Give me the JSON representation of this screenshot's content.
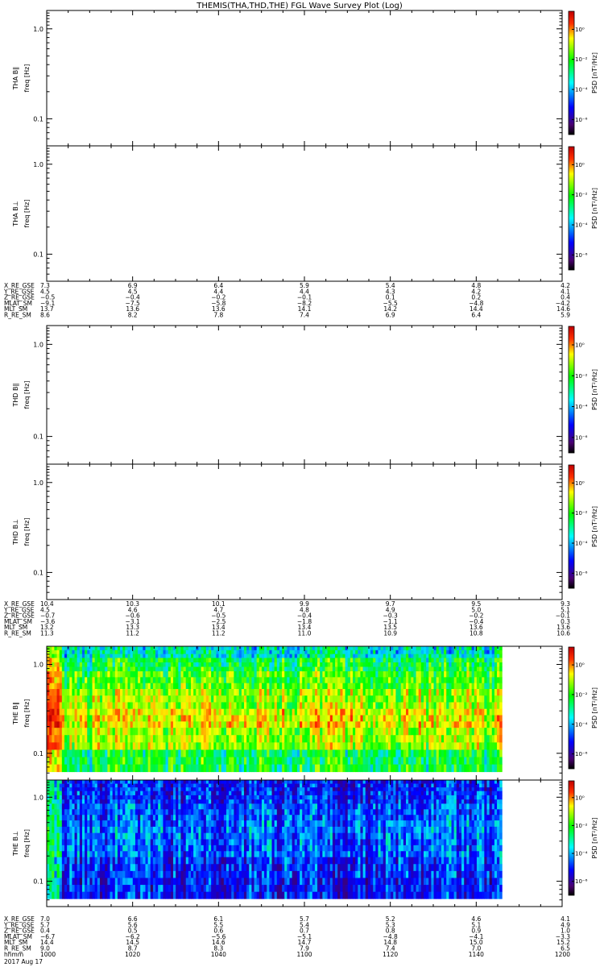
{
  "title": "THEMIS(THA,THD,THE) FGL Wave Survey Plot (Log)",
  "chart_data": {
    "type": "heatmap",
    "yscale": "log",
    "ylim_hz": [
      0.05,
      1.6
    ],
    "yticks": [
      "1.0",
      "0.1"
    ],
    "colorbar": {
      "label": "PSD [nT²/Hz]",
      "ticks": [
        "10⁰",
        "10⁻²",
        "10⁻⁴",
        "10⁻⁶"
      ],
      "colors": [
        "#ffffff",
        "#e00000",
        "#ffff00",
        "#00ff00",
        "#00ffff",
        "#0000ff",
        "#000000"
      ]
    },
    "panels": [
      {
        "probe": "THA",
        "component": "B∥",
        "label": "THA B∥",
        "sublabel": "freq [Hz]",
        "has_data": false
      },
      {
        "probe": "THA",
        "component": "B⊥",
        "label": "THA B⊥",
        "sublabel": "freq [Hz]",
        "has_data": false
      },
      {
        "probe": "THD",
        "component": "B∥",
        "label": "THD B∥",
        "sublabel": "freq [Hz]",
        "has_data": false
      },
      {
        "probe": "THD",
        "component": "B⊥",
        "label": "THD B⊥",
        "sublabel": "freq [Hz]",
        "has_data": false
      },
      {
        "probe": "THE",
        "component": "B∥",
        "label": "THE B∥",
        "sublabel": "freq [Hz]",
        "has_data": true,
        "data_end_hhmm": "1146",
        "psd_log10_bands": [
          {
            "freq_hz": 1.4,
            "value": -3.8
          },
          {
            "freq_hz": 1.0,
            "value": -3.2
          },
          {
            "freq_hz": 0.7,
            "value": -2.8
          },
          {
            "freq_hz": 0.4,
            "value": -2.4
          },
          {
            "freq_hz": 0.25,
            "value": -2.0
          },
          {
            "freq_hz": 0.15,
            "value": -2.4
          },
          {
            "freq_hz": 0.08,
            "value": -3.2
          }
        ]
      },
      {
        "probe": "THE",
        "component": "B⊥",
        "label": "THE B⊥",
        "sublabel": "freq [Hz]",
        "has_data": true,
        "data_end_hhmm": "1146",
        "psd_log10_bands": [
          {
            "freq_hz": 1.4,
            "value": -5.0
          },
          {
            "freq_hz": 1.0,
            "value": -4.9
          },
          {
            "freq_hz": 0.7,
            "value": -4.7
          },
          {
            "freq_hz": 0.4,
            "value": -4.5
          },
          {
            "freq_hz": 0.25,
            "value": -4.6
          },
          {
            "freq_hz": 0.15,
            "value": -4.9
          },
          {
            "freq_hz": 0.08,
            "value": -5.0
          }
        ]
      }
    ],
    "ephemeris_blocks": [
      {
        "after_panel": 1,
        "rows": [
          {
            "label": "X_RE_GSE",
            "values": [
              "7.3",
              "6.9",
              "6.4",
              "5.9",
              "5.4",
              "4.8",
              "4.2"
            ]
          },
          {
            "label": "Y_RE_GSE",
            "values": [
              "4.5",
              "4.5",
              "4.4",
              "4.4",
              "4.3",
              "4.2",
              "4.1"
            ]
          },
          {
            "label": "Z_RE_GSE",
            "values": [
              "−0.5",
              "−0.4",
              "−0.2",
              "−0.1",
              "0.1",
              "0.2",
              "0.4"
            ]
          },
          {
            "label": "MLAT_SM",
            "values": [
              "−9.1",
              "−7.5",
              "−5.8",
              "−8.2",
              "−5.5",
              "−4.8",
              "−4.2"
            ]
          },
          {
            "label": "MLT_SM",
            "values": [
              "13.7",
              "13.6",
              "13.6",
              "14.1",
              "14.2",
              "14.4",
              "14.6"
            ]
          },
          {
            "label": "R_RE_SM",
            "values": [
              "8.6",
              "8.2",
              "7.8",
              "7.4",
              "6.9",
              "6.4",
              "5.9"
            ]
          }
        ]
      },
      {
        "after_panel": 3,
        "rows": [
          {
            "label": "X_RE_GSE",
            "values": [
              "10.4",
              "10.3",
              "10.1",
              "9.9",
              "9.7",
              "9.5",
              "9.3"
            ]
          },
          {
            "label": "Y_RE_GSE",
            "values": [
              "4.5",
              "4.6",
              "4.7",
              "4.8",
              "4.9",
              "5.0",
              "5.1"
            ]
          },
          {
            "label": "Z_RE_GSE",
            "values": [
              "−0.7",
              "−0.6",
              "−0.5",
              "−0.4",
              "−0.3",
              "−0.2",
              "−0.1"
            ]
          },
          {
            "label": "MLAT_SM",
            "values": [
              "−3.6",
              "−3.1",
              "−2.5",
              "−1.8",
              "−1.1",
              "−0.4",
              "0.3"
            ]
          },
          {
            "label": "MLT_SM",
            "values": [
              "13.2",
              "13.3",
              "13.4",
              "13.4",
              "13.5",
              "13.6",
              "13.6"
            ]
          },
          {
            "label": "R_RE_SM",
            "values": [
              "11.3",
              "11.2",
              "11.2",
              "11.0",
              "10.9",
              "10.8",
              "10.6"
            ]
          }
        ]
      },
      {
        "after_panel": 5,
        "rows": [
          {
            "label": "X_RE_GSE",
            "values": [
              "7.0",
              "6.6",
              "6.1",
              "5.7",
              "5.2",
              "4.6",
              "4.1"
            ]
          },
          {
            "label": "Y_RE_GSE",
            "values": [
              "5.7",
              "5.6",
              "5.5",
              "5.4",
              "5.3",
              "5.1",
              "4.9"
            ]
          },
          {
            "label": "Z_RE_GSE",
            "values": [
              "0.4",
              "0.5",
              "0.6",
              "0.7",
              "0.8",
              "0.9",
              "1.0"
            ]
          },
          {
            "label": "MLAT_SM",
            "values": [
              "−6.7",
              "−6.2",
              "−5.6",
              "−5.1",
              "−4.8",
              "−4.1",
              "−3.3"
            ]
          },
          {
            "label": "MLT_SM",
            "values": [
              "14.4",
              "14.5",
              "14.6",
              "14.7",
              "14.8",
              "15.0",
              "15.2"
            ]
          },
          {
            "label": "R_RE_SM",
            "values": [
              "9.0",
              "8.7",
              "8.3",
              "7.9",
              "7.4",
              "7.0",
              "6.5"
            ]
          },
          {
            "label": "hhmm",
            "values": [
              "1000",
              "1020",
              "1040",
              "1100",
              "1120",
              "1140",
              "1200"
            ]
          }
        ]
      }
    ],
    "date_label": "2017 Aug 17"
  }
}
